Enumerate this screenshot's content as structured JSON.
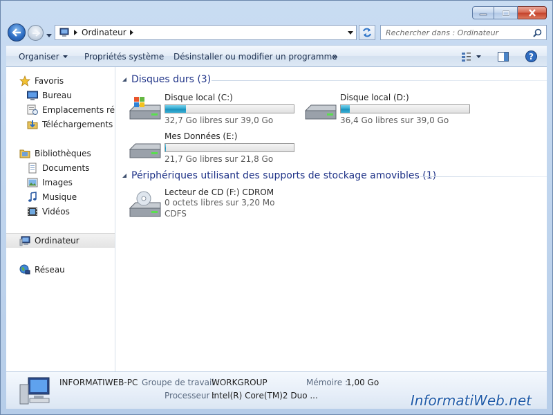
{
  "address": {
    "crumb": "Ordinateur"
  },
  "search": {
    "placeholder": "Rechercher dans : Ordinateur"
  },
  "toolbar": {
    "organize": "Organiser",
    "system_props": "Propriétés système",
    "uninstall": "Désinstaller ou modifier un programme",
    "more": "»"
  },
  "sidebar": {
    "favorites": {
      "label": "Favoris",
      "items": [
        "Bureau",
        "Emplacements récents",
        "Téléchargements"
      ]
    },
    "libraries": {
      "label": "Bibliothèques",
      "items": [
        "Documents",
        "Images",
        "Musique",
        "Vidéos"
      ]
    },
    "computer": "Ordinateur",
    "network": "Réseau"
  },
  "groups": {
    "hard_drives": {
      "title": "Disques durs (3)",
      "drives": [
        {
          "name": "Disque local (C:)",
          "free": "32,7 Go libres sur 39,0 Go",
          "used_fraction": 0.16
        },
        {
          "name": "Disque local (D:)",
          "free": "36,4 Go libres sur 39,0 Go",
          "used_fraction": 0.07
        },
        {
          "name": "Mes Données (E:)",
          "free": "21,7 Go libres sur 21,8 Go",
          "used_fraction": 0.005
        }
      ]
    },
    "removable": {
      "title": "Périphériques utilisant des supports de stockage amovibles (1)",
      "drives": [
        {
          "name": "Lecteur de CD (F:) CDROM",
          "free": "0 octets libres sur 3,20 Mo",
          "fs": "CDFS"
        }
      ]
    }
  },
  "details": {
    "pc_name": "INFORMATIWEB-PC",
    "workgroup_label": "Groupe de travail :",
    "workgroup": "WORKGROUP",
    "memory_label": "Mémoire :",
    "memory": "1,00 Go",
    "cpu_label": "Processeur :",
    "cpu": "Intel(R) Core(TM)2 Duo ..."
  },
  "watermark": "InformatiWeb.net",
  "colors": {
    "accent": "#1e3287",
    "bar_fill": "#2ba7cf",
    "close": "#c3412a"
  }
}
